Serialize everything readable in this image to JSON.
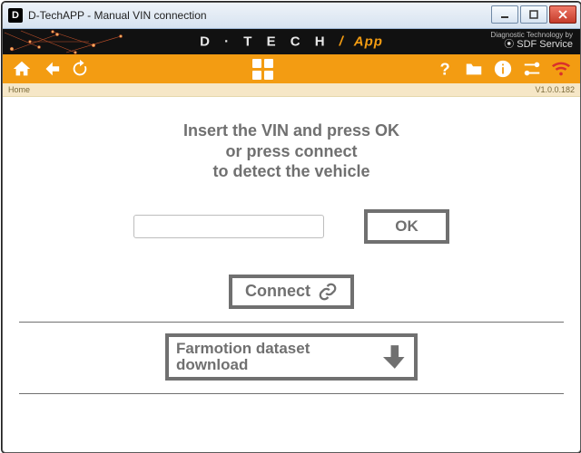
{
  "window": {
    "title": "D-TechAPP - Manual VIN connection",
    "favicon_letter": "D"
  },
  "brand": {
    "name": "D · T E C H",
    "app_label": "App",
    "tagline": "Diagnostic Technology by",
    "company": "SDF Service"
  },
  "crumbs": {
    "path": "Home",
    "version": "V1.0.0.182"
  },
  "main": {
    "prompt_line1": "Insert the VIN and press OK",
    "prompt_line2": "or press connect",
    "prompt_line3": "to detect the vehicle",
    "vin_value": "",
    "vin_placeholder": "",
    "ok_label": "OK",
    "connect_label": "Connect",
    "download_label": "Farmotion dataset download"
  }
}
